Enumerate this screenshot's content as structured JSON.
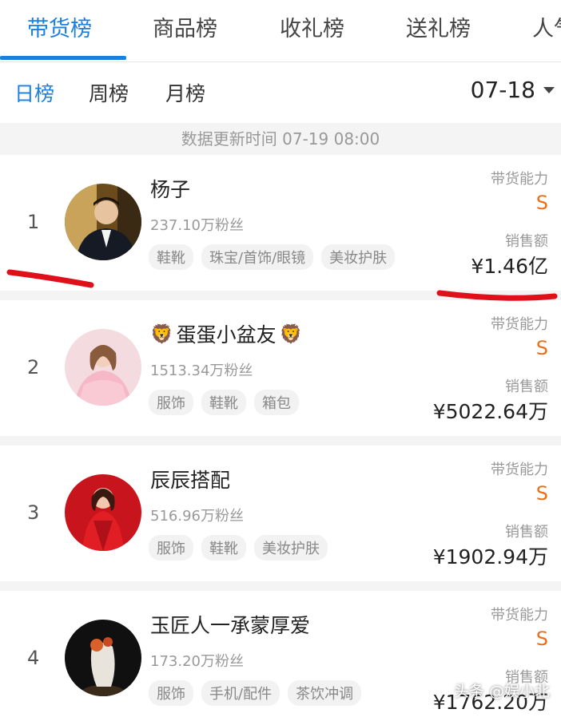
{
  "tabs": [
    {
      "label": "带货榜",
      "active": true
    },
    {
      "label": "商品榜"
    },
    {
      "label": "收礼榜"
    },
    {
      "label": "送礼榜"
    },
    {
      "label": "人气"
    }
  ],
  "subtabs": [
    {
      "label": "日榜",
      "active": true
    },
    {
      "label": "周榜"
    },
    {
      "label": "月榜"
    }
  ],
  "date": {
    "value": "07-18",
    "icon": "chevron-down-icon"
  },
  "update_time": "数据更新时间 07-19 08:00",
  "ability_label": "带货能力",
  "sales_label": "销售额",
  "rows": [
    {
      "rank": "1",
      "name": "杨子",
      "fans": "237.10万粉丝",
      "tags": [
        "鞋靴",
        "珠宝/首饰/眼镜",
        "美妆护肤"
      ],
      "grade": "S",
      "sales": "¥1.46亿"
    },
    {
      "rank": "2",
      "name": "蛋蛋小盆友",
      "name_prefix_icon": "🦁",
      "name_suffix_icon": "🦁",
      "fans": "1513.34万粉丝",
      "tags": [
        "服饰",
        "鞋靴",
        "箱包"
      ],
      "grade": "S",
      "sales": "¥5022.64万"
    },
    {
      "rank": "3",
      "name": "辰辰搭配",
      "fans": "516.96万粉丝",
      "tags": [
        "服饰",
        "鞋靴",
        "美妆护肤"
      ],
      "grade": "S",
      "sales": "¥1902.94万"
    },
    {
      "rank": "4",
      "name": "玉匠人一承蒙厚爱",
      "fans": "173.20万粉丝",
      "tags": [
        "服饰",
        "手机/配件",
        "茶饮冲调"
      ],
      "grade": "S",
      "sales": "¥1762.20万"
    }
  ],
  "watermark": "头条 @娱小北",
  "colors": {
    "accent": "#1a7fe0",
    "grade": "#e8701a",
    "annotation": "#e0101a"
  }
}
